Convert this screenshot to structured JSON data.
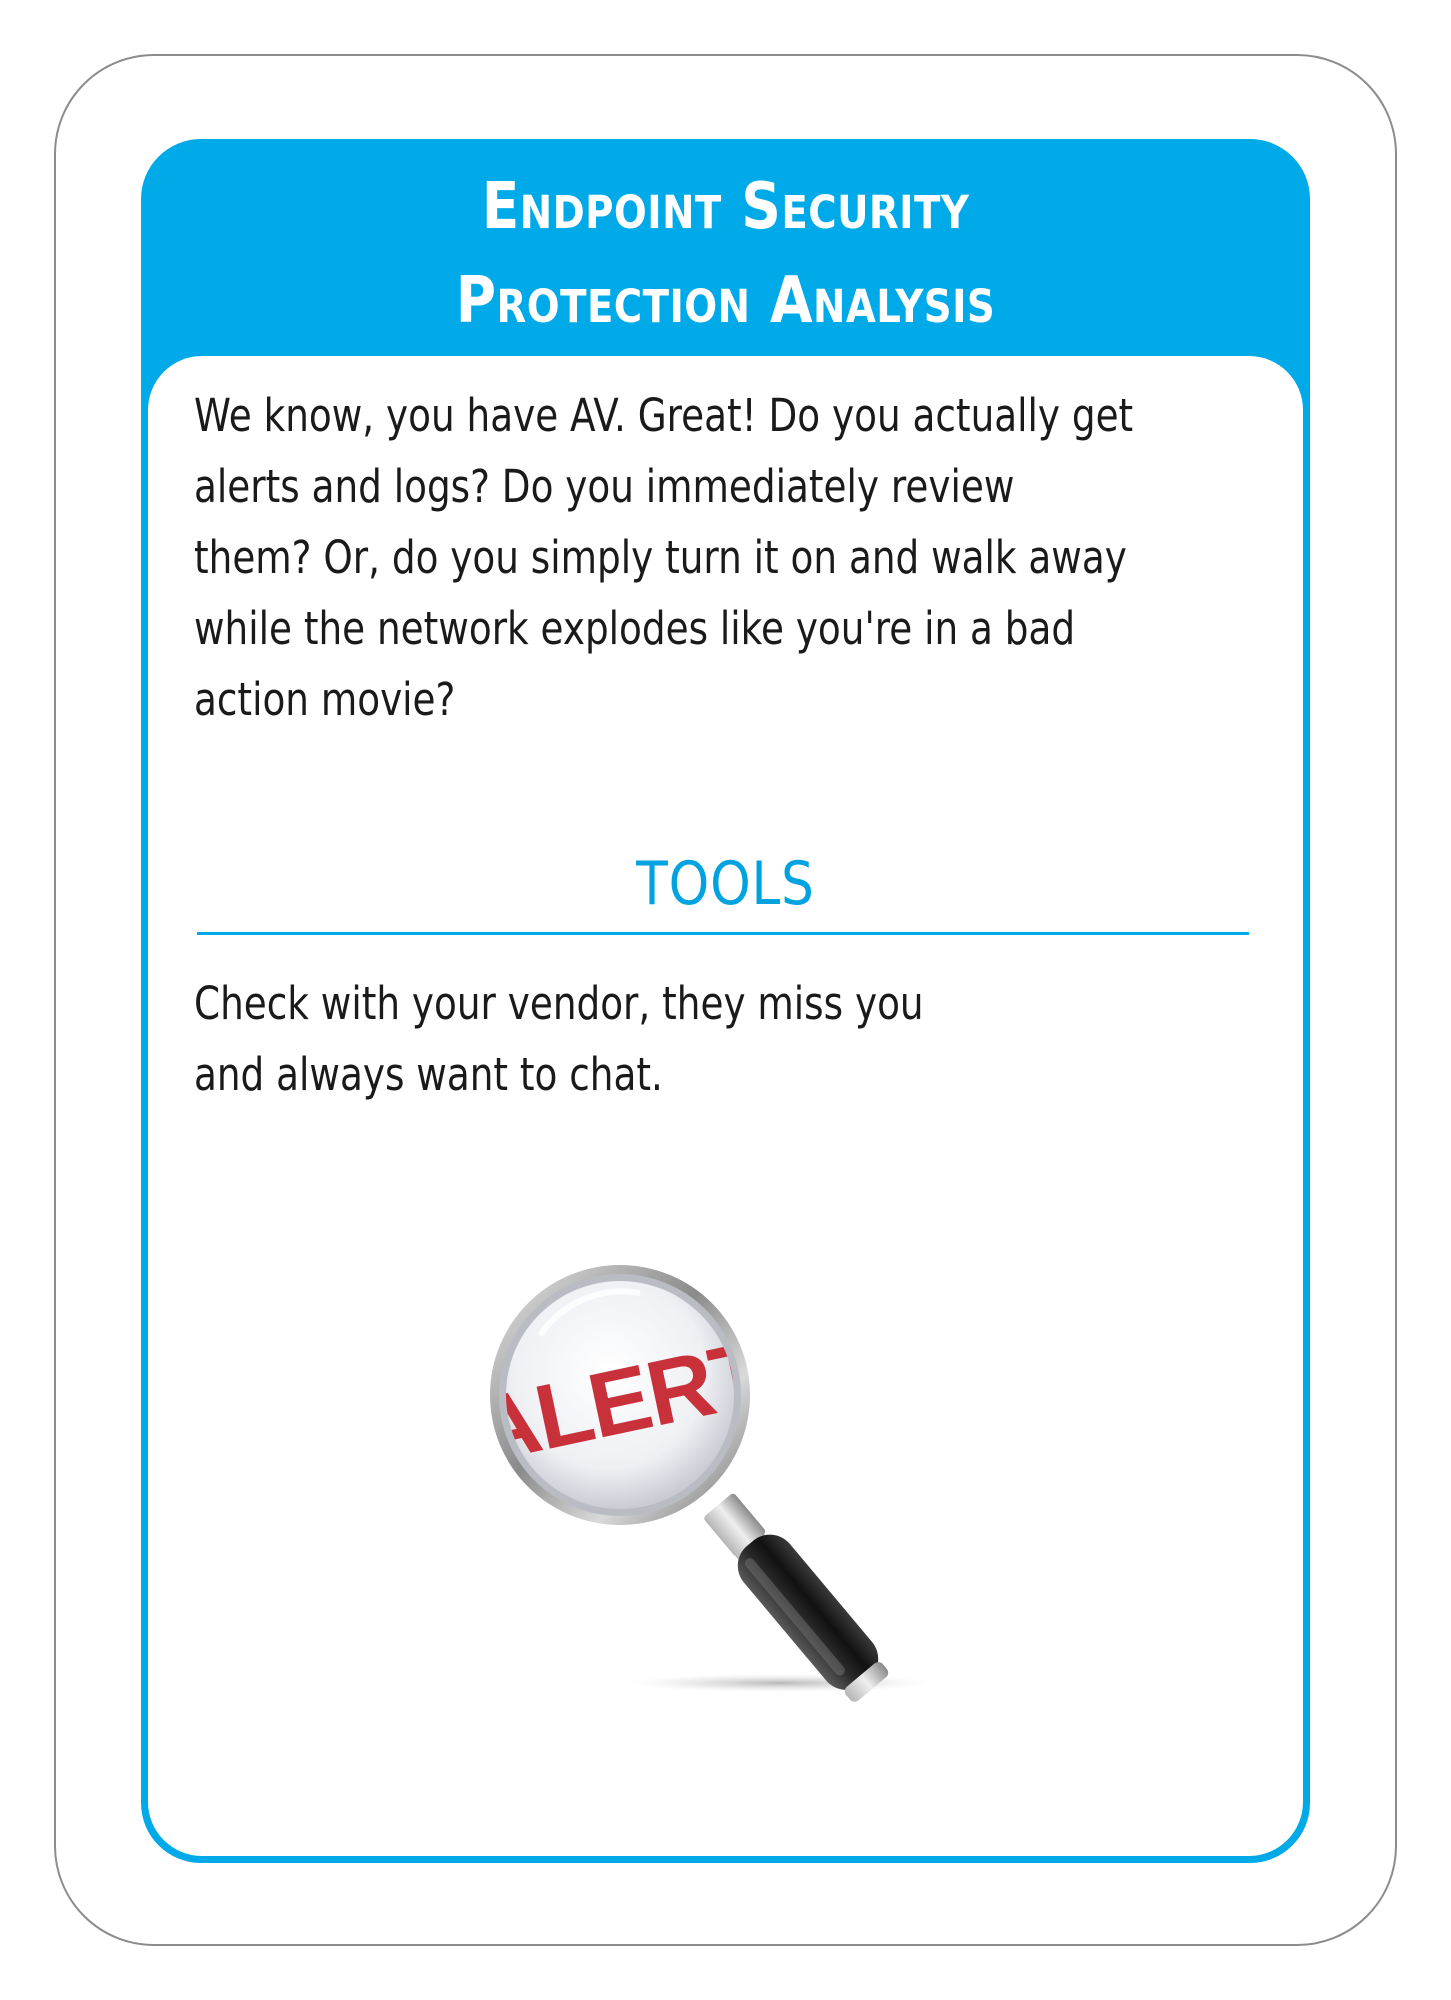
{
  "card": {
    "title_lines": [
      "Endpoint Security",
      "Protection Analysis"
    ],
    "body_lines": [
      "We know, you have AV. Great! Do you actually get",
      "alerts and logs? Do you immediately review",
      "them? Or, do you simply turn it on and walk away",
      "while the network explodes like you're in a bad",
      "action movie?"
    ],
    "tools_heading": "TOOLS",
    "tools_lines": [
      "Check with your vendor, they miss you",
      "and always want to chat."
    ],
    "illustration": {
      "icon": "magnifying-glass-icon",
      "lens_text": "ALERT"
    },
    "colors": {
      "accent": "#00a9e8",
      "alert_red": "#c8303a",
      "text": "#1a1a1a"
    }
  }
}
